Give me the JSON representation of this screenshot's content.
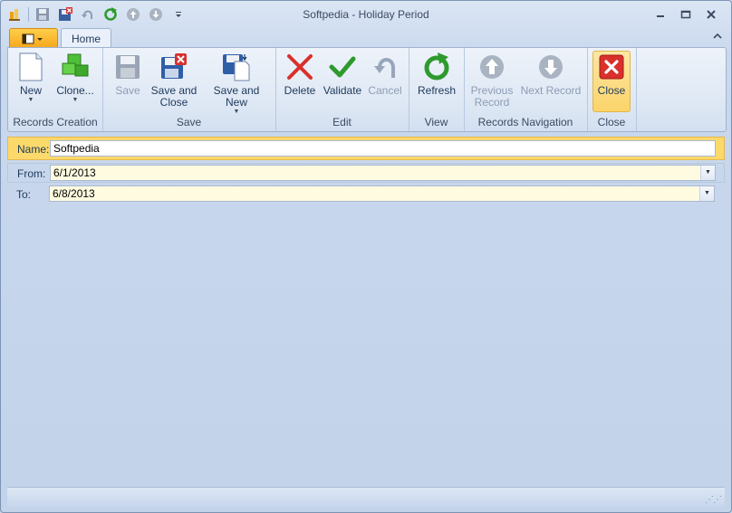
{
  "window": {
    "title": "Softpedia - Holiday Period"
  },
  "qat": [
    "app-icon",
    "save-icon",
    "save-close-icon",
    "undo-icon",
    "refresh-icon",
    "up-icon",
    "down-icon",
    "customize-icon"
  ],
  "tabs": {
    "home": "Home"
  },
  "groups": {
    "records_creation": {
      "label": "Records Creation",
      "buttons": [
        {
          "label": "New"
        },
        {
          "label": "Clone..."
        }
      ]
    },
    "save": {
      "label": "Save",
      "buttons": [
        {
          "label": "Save"
        },
        {
          "label": "Save and\nClose"
        },
        {
          "label": "Save and New"
        }
      ]
    },
    "edit": {
      "label": "Edit",
      "buttons": [
        {
          "label": "Delete"
        },
        {
          "label": "Validate"
        },
        {
          "label": "Cancel"
        }
      ]
    },
    "view": {
      "label": "View",
      "buttons": [
        {
          "label": "Refresh"
        }
      ]
    },
    "records_navigation": {
      "label": "Records Navigation",
      "buttons": [
        {
          "label": "Previous\nRecord"
        },
        {
          "label": "Next Record"
        }
      ]
    },
    "close": {
      "label": "Close",
      "buttons": [
        {
          "label": "Close"
        }
      ]
    }
  },
  "form": {
    "name": {
      "label": "Name:",
      "value": "Softpedia"
    },
    "from": {
      "label": "From:",
      "value": "6/1/2013"
    },
    "to": {
      "label": "To:",
      "value": "6/8/2013"
    }
  },
  "colors": {
    "accent": "#fbd96a",
    "ribbon": "#dde7f4",
    "close_red": "#d9302c",
    "green": "#2e9a2e"
  }
}
